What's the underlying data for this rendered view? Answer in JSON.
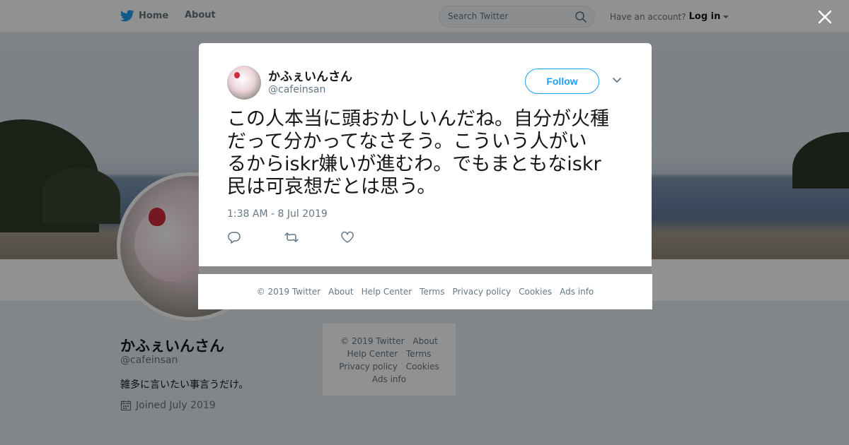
{
  "topbar": {
    "home_label": "Home",
    "about_label": "About",
    "search_placeholder": "Search Twitter",
    "have_account": "Have an account?",
    "login_label": "Log in"
  },
  "profile": {
    "name": "かふぇいんさん",
    "handle": "@cafeinsan",
    "bio": "雑多に言いたい事言うだけ。",
    "joined": "Joined July 2019"
  },
  "side_footer": {
    "copyright": "© 2019 Twitter",
    "about": "About",
    "help": "Help Center",
    "terms": "Terms",
    "privacy": "Privacy policy",
    "cookies": "Cookies",
    "ads": "Ads info"
  },
  "tweet": {
    "name": "かふぇいんさん",
    "handle": "@cafeinsan",
    "follow_label": "Follow",
    "text_lines": [
      "この人本当に頭おかしいんだね。自分が火種",
      "だって分かってなさそう。こういう人がい",
      "るからiskr嫌いが進むわ。でもまともなiskr",
      "民は可哀想だとは思う。"
    ],
    "timestamp": "1:38 AM - 8 Jul 2019"
  },
  "modal_footer": {
    "copyright": "© 2019 Twitter",
    "about": "About",
    "help": "Help Center",
    "terms": "Terms",
    "privacy": "Privacy policy",
    "cookies": "Cookies",
    "ads": "Ads info"
  },
  "colors": {
    "brand_blue": "#1da1f2",
    "text_primary": "#14171a",
    "text_secondary": "#657786"
  },
  "icons": [
    "twitter-bird-icon",
    "search-icon",
    "close-icon",
    "chevron-down-icon",
    "reply-icon",
    "retweet-icon",
    "like-icon",
    "calendar-icon"
  ]
}
